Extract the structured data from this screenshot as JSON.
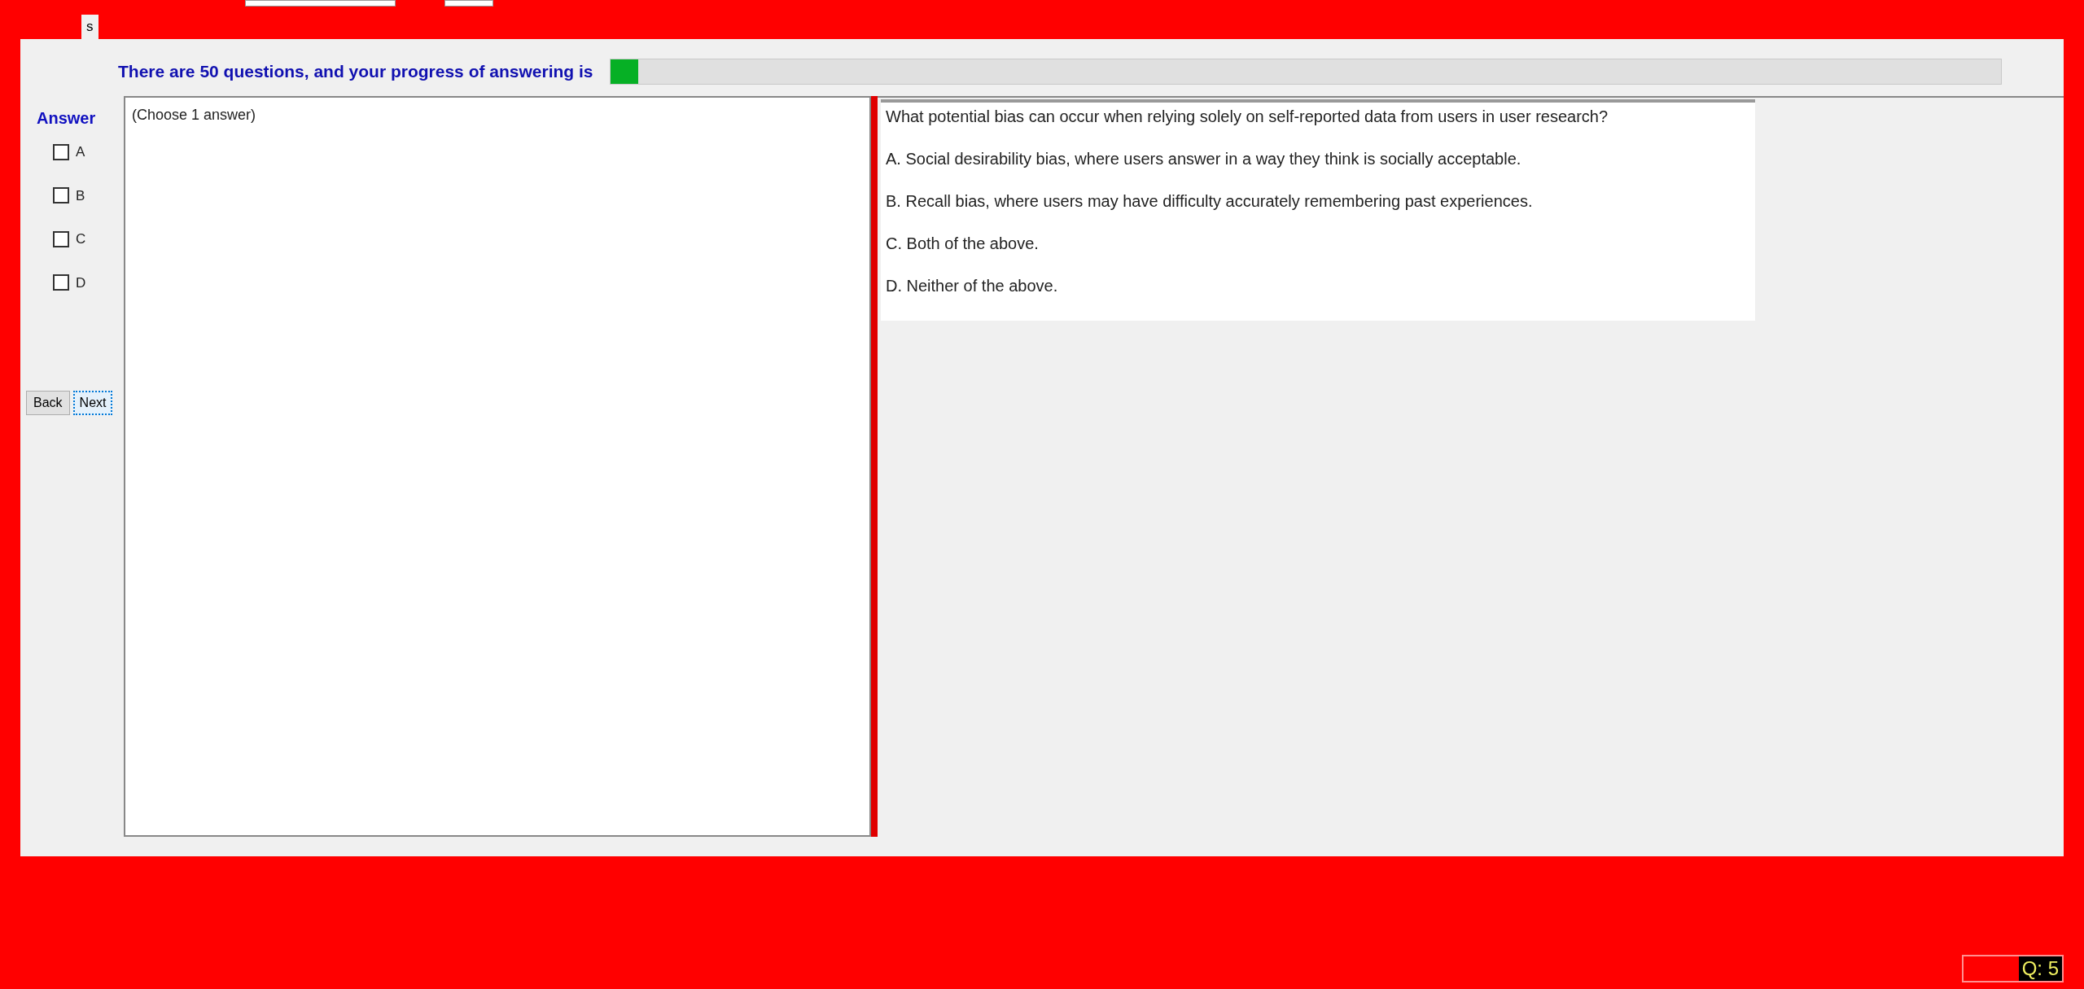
{
  "tabs": [
    {
      "label": "s",
      "selected": true
    }
  ],
  "progress": {
    "label": "There are 50 questions, and your progress of answering is",
    "level": 0.02
  },
  "answer_panel": {
    "title": "Answer",
    "options": [
      {
        "label": "A",
        "checked": false
      },
      {
        "label": "B",
        "checked": false
      },
      {
        "label": "C",
        "checked": false
      },
      {
        "label": "D",
        "checked": false
      }
    ]
  },
  "buttons": [
    {
      "label": "Back",
      "focused": false
    },
    {
      "label": "Next",
      "focused": true
    }
  ],
  "answer_box": {
    "hint": "(Choose 1 answer)"
  },
  "question": {
    "text": "What potential bias can occur when relying solely on self-reported data from users in user research?",
    "choices": [
      "A.  Social desirability bias, where users answer in a way they think is socially acceptable.",
      "B.  Recall bias, where users may have difficulty accurately remembering past experiences.",
      "C.  Both of the above.",
      "D.  Neither of the above."
    ]
  },
  "question_counter": "Q: 5"
}
